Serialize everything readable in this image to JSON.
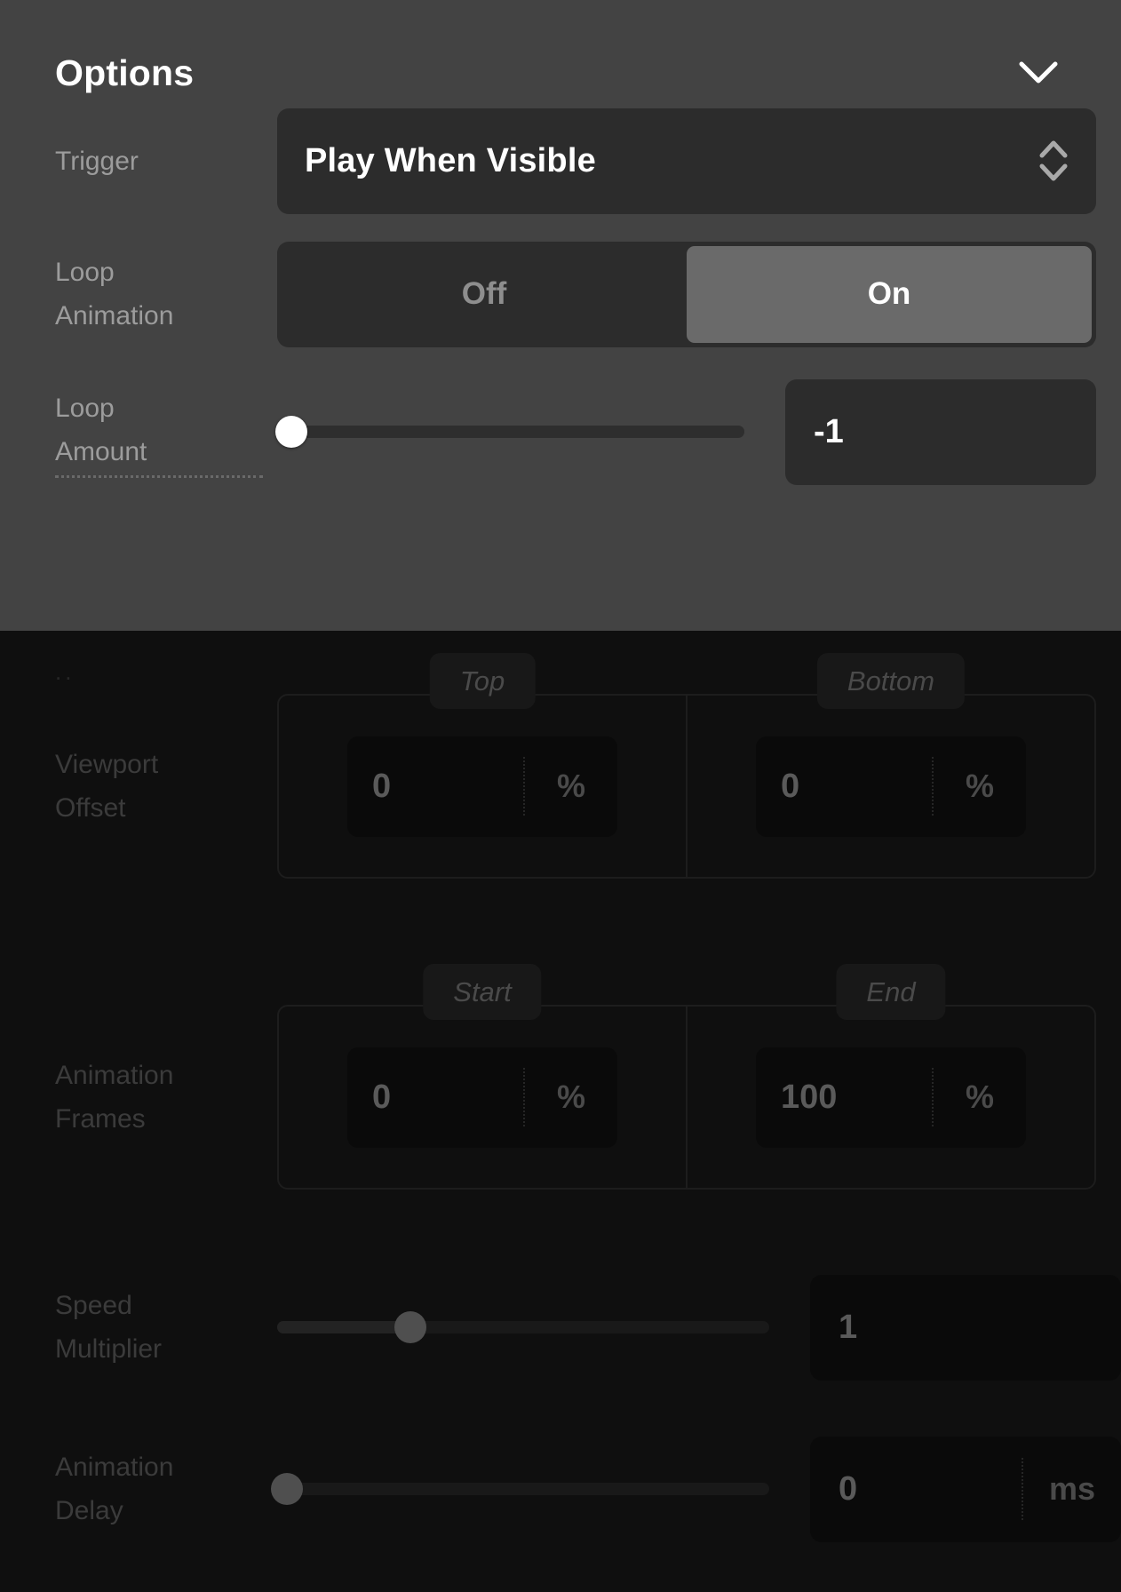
{
  "header": {
    "title": "Options",
    "collapse_icon": "chevron-down-icon"
  },
  "trigger": {
    "label": "Trigger",
    "value": "Play When Visible",
    "stepper_icon": "chevron-up-down-icon"
  },
  "loop_animation": {
    "label_line1": "Loop",
    "label_line2": "Animation",
    "options": [
      "Off",
      "On"
    ],
    "selected": "On"
  },
  "loop_amount": {
    "label_line1": "Loop",
    "label_line2": "Amount",
    "value": "-1",
    "slider_percent": 3
  },
  "viewport_offset": {
    "label_line1": "Viewport",
    "label_line2": "Offset",
    "stray_marks": "..",
    "cells": [
      {
        "legend": "Top",
        "value": "0",
        "unit": "%"
      },
      {
        "legend": "Bottom",
        "value": "0",
        "unit": "%"
      }
    ]
  },
  "animation_frames": {
    "label_line1": "Animation",
    "label_line2": "Frames",
    "cells": [
      {
        "legend": "Start",
        "value": "0",
        "unit": "%"
      },
      {
        "legend": "End",
        "value": "100",
        "unit": "%"
      }
    ]
  },
  "speed_multiplier": {
    "label_line1": "Speed",
    "label_line2": "Multiplier",
    "value": "1",
    "slider_percent": 27
  },
  "animation_delay": {
    "label_line1": "Animation",
    "label_line2": "Delay",
    "value": "0",
    "unit": "ms",
    "slider_percent": 2
  },
  "colors": {
    "panel_active_bg": "#434343",
    "panel_dim_bg": "#0f0f0f",
    "field_bg": "#2c2c2c",
    "selected_segment": "#6a6a6a",
    "text_primary": "#ffffff",
    "text_label": "#9c9c9c"
  }
}
